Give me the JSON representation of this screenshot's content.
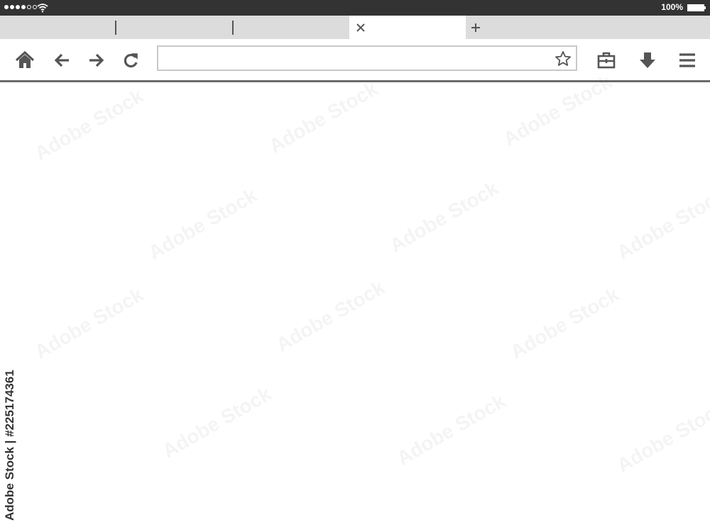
{
  "status_bar": {
    "signal_dots_filled": 4,
    "signal_dots_empty": 2,
    "wifi_icon": "wifi-icon",
    "battery_percent": "100%",
    "battery_icon": "battery-icon"
  },
  "tabs": {
    "tab_count": 4,
    "active_index": 3,
    "close_icon": "close-icon",
    "new_tab_icon": "plus-icon"
  },
  "toolbar": {
    "icons": [
      "home-icon",
      "back-arrow-icon",
      "forward-arrow-icon",
      "reload-icon",
      "star-icon",
      "briefcase-icon",
      "download-icon",
      "menu-icon"
    ],
    "address_value": "",
    "address_placeholder": ""
  },
  "watermark": {
    "text": "Adobe Stock",
    "id_text": "Adobe Stock | #225174361"
  },
  "colors": {
    "status_bar_bg": "#333333",
    "tab_strip_bg": "#dcdcdc",
    "icon": "#555555",
    "toolbar_border": "#6a6a6a"
  }
}
